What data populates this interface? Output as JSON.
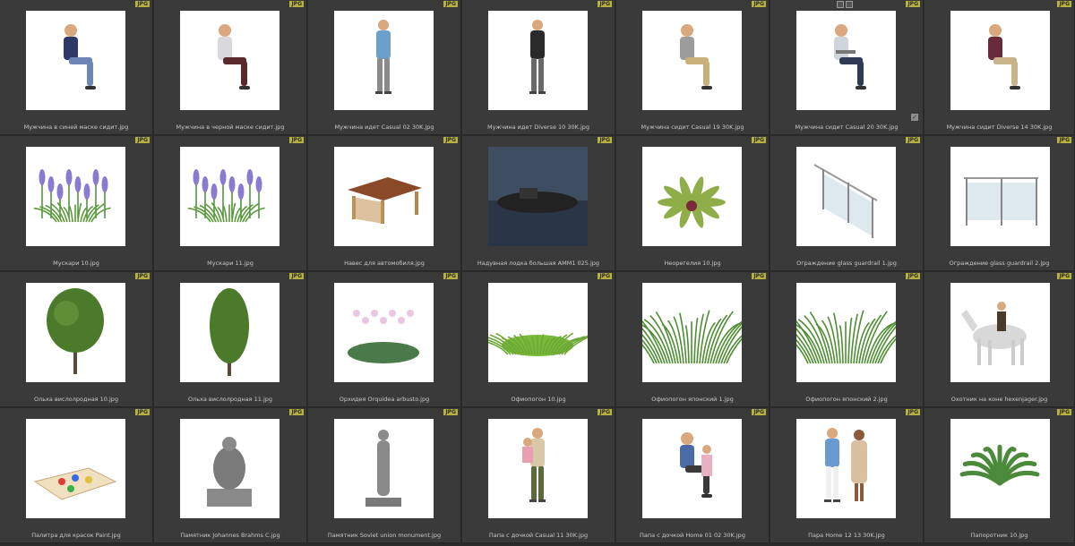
{
  "badge_text": "JPG",
  "items": [
    {
      "label": "Мужчина в синей маске сидит.jpg",
      "thumb": "man-blue-mask-sitting"
    },
    {
      "label": "Мужчина в черной маске сидит.jpg",
      "thumb": "man-black-mask-sitting"
    },
    {
      "label": "Мужчина идет Casual 02 30K.jpg",
      "thumb": "man-walking"
    },
    {
      "label": "Мужчина идет Diverse 10 30K.jpg",
      "thumb": "man-standing-jacket"
    },
    {
      "label": "Мужчина сидит Casual 19 30K.jpg",
      "thumb": "man-sitting-casual"
    },
    {
      "label": "Мужчина сидит Casual 20 30K.jpg",
      "thumb": "man-sitting-laptop",
      "selected": true
    },
    {
      "label": "Мужчина сидит Diverse 14 30K.jpg",
      "thumb": "man-sitting-diverse"
    },
    {
      "label": "Мускари 10.jpg",
      "thumb": "muscari"
    },
    {
      "label": "Мускари 11.jpg",
      "thumb": "muscari"
    },
    {
      "label": "Навес для автомобиля.jpg",
      "thumb": "carport"
    },
    {
      "label": "Надувная лодка большая AMM1 025.jpg",
      "thumb": "boat"
    },
    {
      "label": "Неорегелия 10.jpg",
      "thumb": "neoregelia"
    },
    {
      "label": "Ограждение glass guardrail 1.jpg",
      "thumb": "guardrail-stairs"
    },
    {
      "label": "Ограждение glass guardrail 2.jpg",
      "thumb": "guardrail-flat"
    },
    {
      "label": "Ольха вислолродная 10.jpg",
      "thumb": "tree-round"
    },
    {
      "label": "Ольха вислолродная 11.jpg",
      "thumb": "tree-tall"
    },
    {
      "label": "Орхидея Orquidea arbusto.jpg",
      "thumb": "orchid"
    },
    {
      "label": "Офиопогон 10.jpg",
      "thumb": "grass-low"
    },
    {
      "label": "Офиопогон японский 1.jpg",
      "thumb": "grass-tall"
    },
    {
      "label": "Офиопогон японский 2.jpg",
      "thumb": "grass-tall"
    },
    {
      "label": "Охотник на коне hexenjager.jpg",
      "thumb": "horse-rider"
    },
    {
      "label": "Палитра для красок Paint.jpg",
      "thumb": "palette"
    },
    {
      "label": "Памятник Johannes Brahms C.jpg",
      "thumb": "statue-seated"
    },
    {
      "label": "Памятник Soviet union monument.jpg",
      "thumb": "statue-standing"
    },
    {
      "label": "Папа с дочкой Casual 11 30K.jpg",
      "thumb": "dad-daughter-hold"
    },
    {
      "label": "Папа с дочкой Home 01 02 30K.jpg",
      "thumb": "dad-daughter-kneel"
    },
    {
      "label": "Пара Home 12 13 30K.jpg",
      "thumb": "couple"
    },
    {
      "label": "Папоротник 10.jpg",
      "thumb": "fern"
    }
  ]
}
